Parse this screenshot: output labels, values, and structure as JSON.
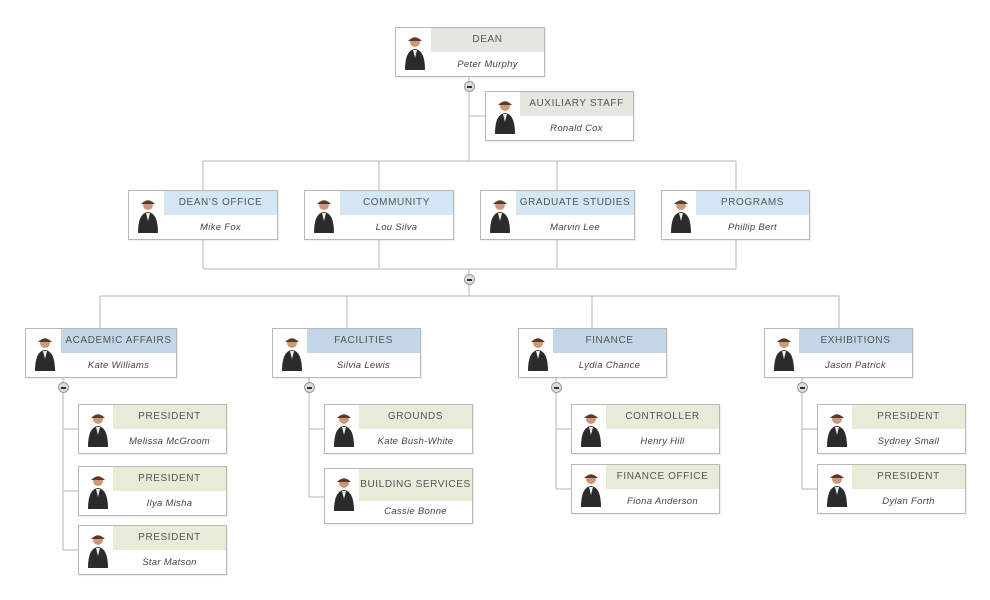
{
  "chart_title": "",
  "colors": {
    "line": "#b5b5b5",
    "header_dean": "#e4e6df",
    "header_level2": "#d3e7f4",
    "header_level3": "#c3d6e8",
    "header_leaf": "#e7ecd9"
  },
  "nodes": {
    "dean": {
      "title": "DEAN",
      "name": "Peter Murphy",
      "photo": "person-photo-icon"
    },
    "auxiliary": {
      "title": "AUXILIARY STAFF",
      "name": "Ronald Cox",
      "photo": "person-photo-icon"
    },
    "deans_office": {
      "title": "DEAN'S OFFICE",
      "name": "Mike Fox",
      "photo": "person-photo-icon"
    },
    "community": {
      "title": "COMMUNITY",
      "name": "Lou Silva",
      "photo": "person-photo-icon"
    },
    "graduate": {
      "title": "GRADUATE STUDIES",
      "name": "Marvin Lee",
      "photo": "person-photo-icon"
    },
    "programs": {
      "title": "PROGRAMS",
      "name": "Phillip Bert",
      "photo": "person-photo-icon"
    },
    "academic": {
      "title": "ACADEMIC AFFAIRS",
      "name": "Kate Williams",
      "photo": "person-photo-icon"
    },
    "facilities": {
      "title": "FACILITIES",
      "name": "Silvia Lewis",
      "photo": "person-photo-icon"
    },
    "finance": {
      "title": "FINANCE",
      "name": "Lydia Chance",
      "photo": "person-photo-icon"
    },
    "exhibitions": {
      "title": "EXHIBITIONS",
      "name": "Jason Patrick",
      "photo": "person-photo-icon"
    },
    "aa1": {
      "title": "PRESIDENT",
      "name": "Melissa McGroom",
      "photo": "person-photo-icon"
    },
    "aa2": {
      "title": "PRESIDENT",
      "name": "Ilya Misha",
      "photo": "person-photo-icon"
    },
    "aa3": {
      "title": "PRESIDENT",
      "name": "Star Matson",
      "photo": "person-photo-icon"
    },
    "fa1": {
      "title": "GROUNDS",
      "name": "Kate Bush-White",
      "photo": "person-photo-icon"
    },
    "fa2": {
      "title": "BUILDING SERVICES",
      "name": "Cassie Bonne",
      "photo": "person-photo-icon"
    },
    "fi1": {
      "title": "CONTROLLER",
      "name": "Henry Hill",
      "photo": "person-photo-icon"
    },
    "fi2": {
      "title": "FINANCE OFFICE",
      "name": "Fiona Anderson",
      "photo": "person-photo-icon"
    },
    "ex1": {
      "title": "PRESIDENT",
      "name": "Sydney Small",
      "photo": "person-photo-icon"
    },
    "ex2": {
      "title": "PRESIDENT",
      "name": "Dylan Forth",
      "photo": "person-photo-icon"
    }
  },
  "toggles": {
    "symbol": "collapse"
  }
}
